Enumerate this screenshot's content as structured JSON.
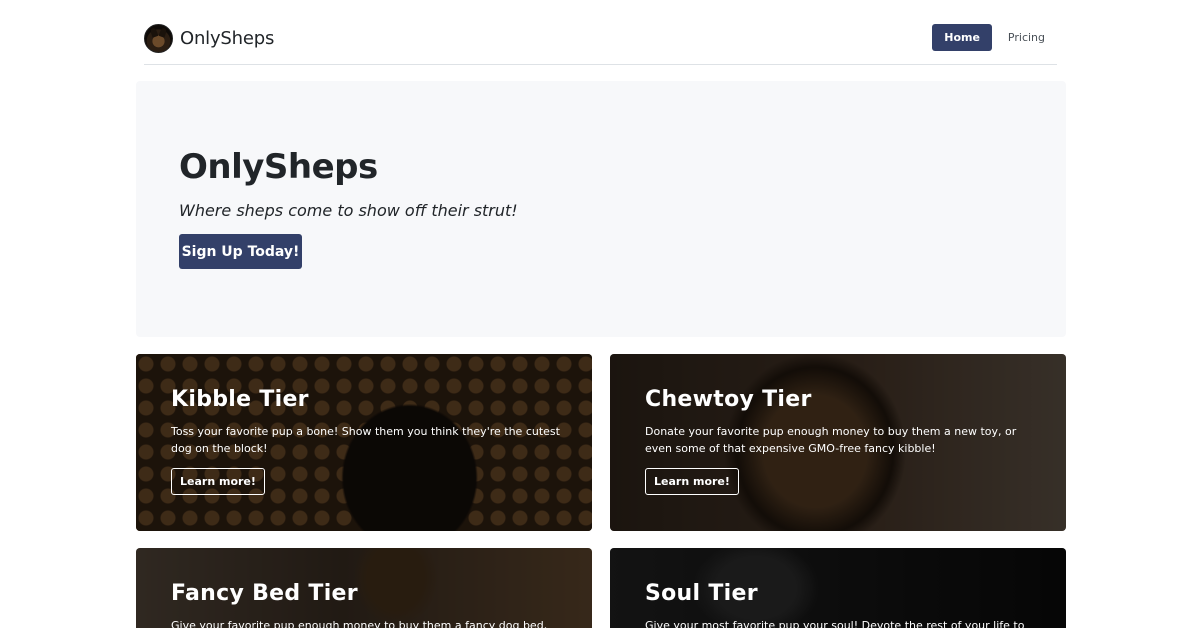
{
  "brand": {
    "name": "OnlySheps"
  },
  "nav": {
    "items": [
      {
        "label": "Home",
        "active": true
      },
      {
        "label": "Pricing",
        "active": false
      }
    ]
  },
  "hero": {
    "title": "OnlySheps",
    "subtitle": "Where sheps come to show off their strut!",
    "cta_label": "Sign Up Today!"
  },
  "tiers": [
    {
      "title": "Kibble Tier",
      "description": "Toss your favorite pup a bone! Show them you think they're the cutest dog on the block!",
      "button_label": "Learn more!"
    },
    {
      "title": "Chewtoy Tier",
      "description": "Donate your favorite pup enough money to buy them a new toy, or even some of that expensive GMO-free fancy kibble!",
      "button_label": "Learn more!"
    },
    {
      "title": "Fancy Bed Tier",
      "description": "Give your favorite pup enough money to buy them a fancy dog bed, or a",
      "button_label": ""
    },
    {
      "title": "Soul Tier",
      "description": "Give your most favorite pup your soul! Devote the rest of your life to",
      "button_label": ""
    }
  ],
  "colors": {
    "primary": "#334069",
    "hero_bg": "#f7f8fa"
  }
}
